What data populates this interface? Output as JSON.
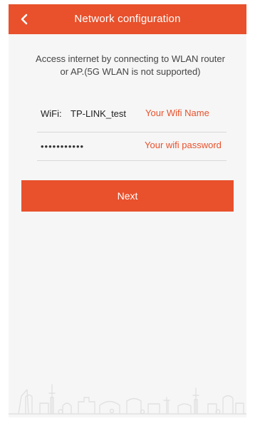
{
  "header": {
    "back_icon": "chevron-left-icon",
    "title": "Network configuration"
  },
  "intro": {
    "text": "Access internet by connecting to WLAN router or AP.(5G WLAN is not supported)"
  },
  "wifi": {
    "label": "WiFi:",
    "value": "TP-LINK_test",
    "hint": "Your Wifi Name"
  },
  "password": {
    "value": "•••••••••••",
    "hint": "Your wifi password"
  },
  "actions": {
    "next_label": "Next"
  },
  "colors": {
    "accent": "#e8512c",
    "background": "#f6f6f6",
    "text": "#222222",
    "muted_text": "#444444"
  },
  "decor": {
    "skyline_icon": "city-skyline-icon"
  }
}
